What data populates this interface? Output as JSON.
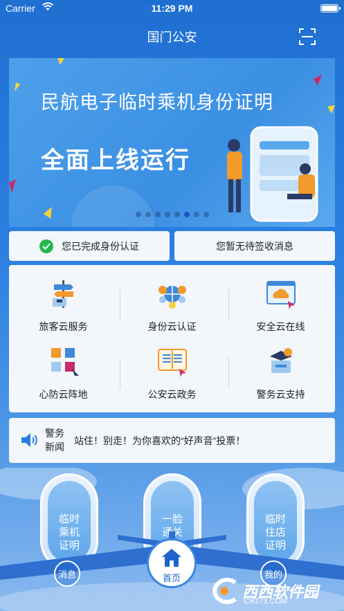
{
  "status_bar": {
    "carrier": "Carrier",
    "time": "11:29 PM"
  },
  "nav": {
    "title": "国门公安",
    "scan_icon": "scan-icon"
  },
  "banner": {
    "line1": "民航电子临时乘机身份证明",
    "line2": "全面上线运行",
    "page_count": 8,
    "active_index": 5
  },
  "notices": {
    "identity": "您已完成身份认证",
    "messages": "您暂无待签收消息"
  },
  "services": [
    {
      "label": "旅客云服务",
      "icon": "signpost-icon"
    },
    {
      "label": "身份云认证",
      "icon": "identity-globe-icon"
    },
    {
      "label": "安全云在线",
      "icon": "cloud-browser-icon"
    },
    {
      "label": "心防云阵地",
      "icon": "cubes-icon"
    },
    {
      "label": "公安云政务",
      "icon": "open-book-icon"
    },
    {
      "label": "警务云支持",
      "icon": "police-support-icon"
    }
  ],
  "news": {
    "label": "警务新闻",
    "headline": "站住！别走！为你喜欢的“好声音”投票！"
  },
  "plane_windows": [
    {
      "text": "临时乘机证明"
    },
    {
      "text": "一脸通关"
    },
    {
      "text": "临时住店证明"
    }
  ],
  "tabbar": {
    "messages": "消息",
    "home": "首页",
    "mine": "我的"
  },
  "watermark": {
    "brand": "西西软件园",
    "site": "CR173.COM"
  },
  "colors": {
    "primary": "#1f6fd1",
    "success": "#23b94b",
    "panel": "#f3f6fb"
  }
}
